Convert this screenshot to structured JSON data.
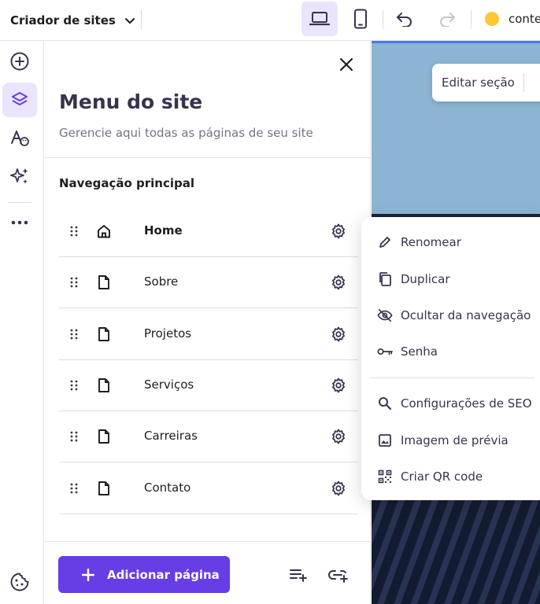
{
  "topbar": {
    "brand_label": "Criador de sites",
    "domain_text": "conte"
  },
  "rail": {
    "items": [
      "add-icon",
      "layers-icon",
      "styles-icon",
      "ai-sparkle-icon",
      "more-icon",
      "cookie-icon"
    ]
  },
  "panel": {
    "title": "Menu do site",
    "subtitle": "Gerencie aqui todas as páginas de seu site",
    "section_title": "Navegação principal",
    "pages": [
      {
        "label": "Home",
        "icon": "home-icon"
      },
      {
        "label": "Sobre",
        "icon": "page-icon"
      },
      {
        "label": "Projetos",
        "icon": "page-icon"
      },
      {
        "label": "Serviços",
        "icon": "page-icon"
      },
      {
        "label": "Carreiras",
        "icon": "page-icon"
      },
      {
        "label": "Contato",
        "icon": "page-icon"
      }
    ],
    "add_page_label": "Adicionar página"
  },
  "canvas": {
    "edit_section_label": "Editar seção"
  },
  "context_menu": {
    "items": [
      {
        "label": "Renomear",
        "icon": "pencil-icon"
      },
      {
        "label": "Duplicar",
        "icon": "duplicate-icon"
      },
      {
        "label": "Ocultar da navegação",
        "icon": "eye-off-icon"
      },
      {
        "label": "Senha",
        "icon": "key-icon"
      },
      {
        "label": "Configurações de SEO",
        "icon": "search-icon"
      },
      {
        "label": "Imagem de prévia",
        "icon": "image-icon"
      },
      {
        "label": "Criar QR code",
        "icon": "qr-code-icon"
      }
    ]
  },
  "colors": {
    "accent": "#673de6",
    "accent_light": "#ebe4ff",
    "status_dot": "#fcc934",
    "text_primary": "#1d1e20",
    "text_secondary": "#727586"
  }
}
